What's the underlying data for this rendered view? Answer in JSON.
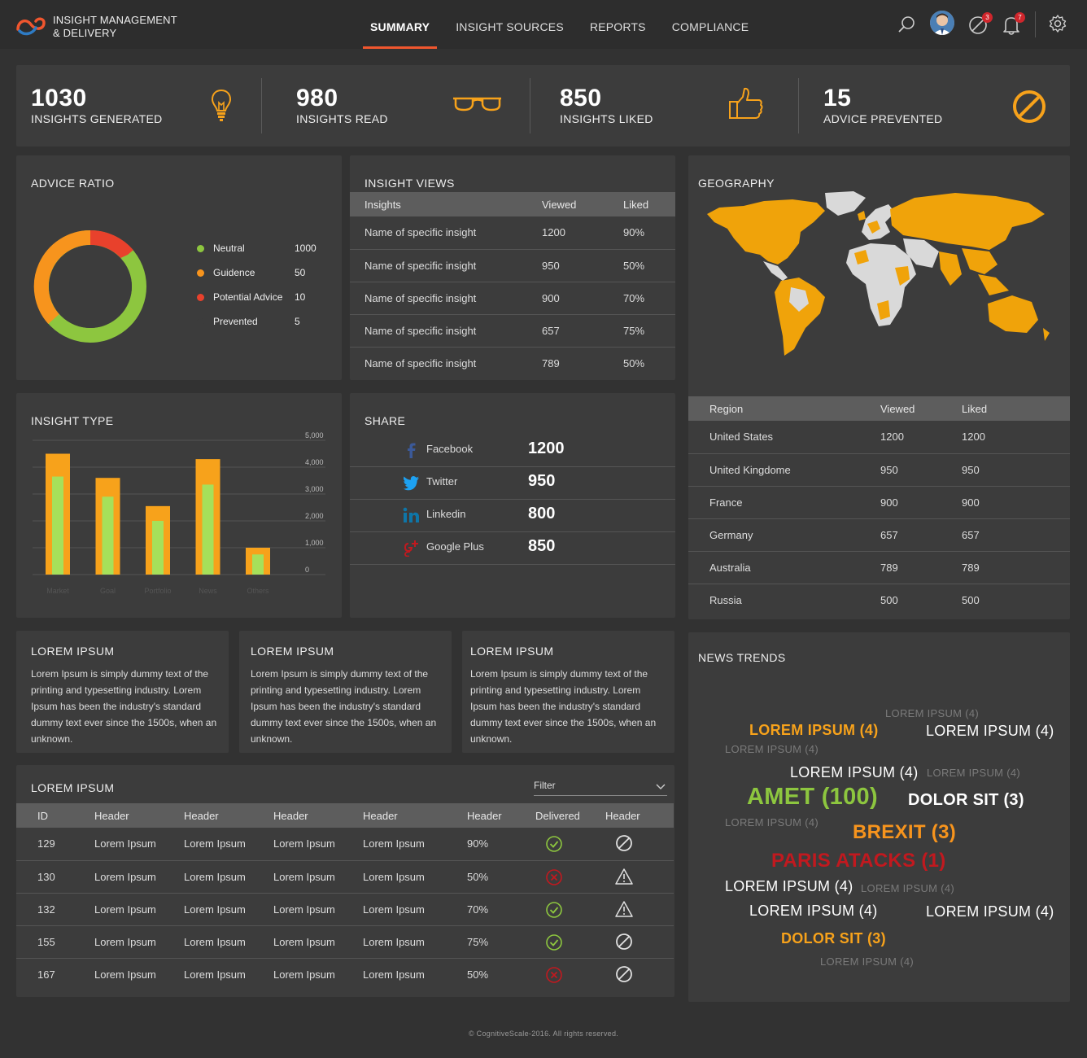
{
  "app": {
    "brand_line1": "INSIGHT MANAGEMENT",
    "brand_line2": "& DELIVERY"
  },
  "nav": {
    "items": [
      {
        "label": "SUMMARY",
        "active": true
      },
      {
        "label": "INSIGHT SOURCES",
        "active": false
      },
      {
        "label": "REPORTS",
        "active": false
      },
      {
        "label": "COMPLIANCE",
        "active": false
      }
    ],
    "icons": [
      "search-icon",
      "avatar",
      "prevented-icon",
      "bell-icon",
      "gear-icon"
    ],
    "prevented_badge": "3",
    "alerts_badge": "7"
  },
  "kpis": [
    {
      "value": "1030",
      "label": "INSIGHTS GENERATED",
      "icon": "lightbulb-icon"
    },
    {
      "value": "980",
      "label": "INSIGHTS READ",
      "icon": "glasses-icon"
    },
    {
      "value": "850",
      "label": "INSIGHTS LIKED",
      "icon": "thumbs-up-icon"
    },
    {
      "value": "15",
      "label": "ADVICE PREVENTED",
      "icon": "prohibited-icon"
    }
  ],
  "advice_ratio": {
    "title": "ADVICE RATIO",
    "legend": [
      {
        "label": "Neutral",
        "value": "1000",
        "color": "#8dc63f"
      },
      {
        "label": "Guidence",
        "value": "50",
        "color": "#f7941d"
      },
      {
        "label": "Potential Advice",
        "value": "10",
        "color": "#e8412c"
      },
      {
        "label": "Prevented",
        "value": "5",
        "color": "#3c3c3c"
      }
    ]
  },
  "insight_views": {
    "title": "INSIGHT VIEWS",
    "headers": [
      "Insights",
      "Viewed",
      "Liked"
    ],
    "rows": [
      [
        "Name of specific insight",
        "1200",
        "90%"
      ],
      [
        "Name of specific insight",
        "950",
        "50%"
      ],
      [
        "Name of specific insight",
        "900",
        "70%"
      ],
      [
        "Name of specific insight",
        "657",
        "75%"
      ],
      [
        "Name of specific insight",
        "789",
        "50%"
      ]
    ]
  },
  "geography": {
    "title": "GEOGRAPHY",
    "headers": [
      "Region",
      "Viewed",
      "Liked"
    ],
    "rows": [
      [
        "United States",
        "1200",
        "1200"
      ],
      [
        "United Kingdome",
        "950",
        "950"
      ],
      [
        "France",
        "900",
        "900"
      ],
      [
        "Germany",
        "657",
        "657"
      ],
      [
        "Australia",
        "789",
        "789"
      ],
      [
        "Russia",
        "500",
        "500"
      ]
    ]
  },
  "insight_type": {
    "title": "INSIGHT TYPE"
  },
  "chart_data": {
    "type": "bar",
    "categories": [
      "Market",
      "Goal",
      "Portfolio",
      "News",
      "Others"
    ],
    "series": [
      {
        "values": [
          4500,
          3600,
          2550,
          4300,
          1000
        ],
        "color": "#f7a21b"
      },
      {
        "values": [
          3650,
          2900,
          2000,
          3350,
          750
        ],
        "color": "#a6e05a"
      }
    ],
    "yticks": [
      "5,000",
      "4,000",
      "3,000",
      "2,000",
      "1,000",
      "0"
    ],
    "ylim": [
      0,
      5000
    ],
    "grid": true
  },
  "share": {
    "title": "SHARE",
    "rows": [
      {
        "name": "Facebook",
        "value": "1200",
        "icon": "facebook-icon"
      },
      {
        "name": "Twitter",
        "value": "950",
        "icon": "twitter-icon"
      },
      {
        "name": "Linkedin",
        "value": "800",
        "icon": "linkedin-icon"
      },
      {
        "name": "Google Plus",
        "value": "850",
        "icon": "google-plus-icon"
      }
    ]
  },
  "cards": [
    {
      "title": "LOREM IPSUM",
      "text": "Lorem Ipsum is simply dummy text of the printing and typesetting industry. Lorem Ipsum has been the industry's standard dummy text ever since the 1500s, when an unknown."
    },
    {
      "title": "LOREM IPSUM",
      "text": "Lorem Ipsum is simply dummy text of the printing and typesetting industry. Lorem Ipsum has been the industry's standard dummy text ever since the 1500s, when an unknown."
    },
    {
      "title": "LOREM IPSUM",
      "text": "Lorem Ipsum is simply dummy text of the printing and typesetting industry. Lorem Ipsum has been the industry's standard dummy text ever since the 1500s, when an unknown."
    }
  ],
  "lorem_table": {
    "title": "LOREM IPSUM",
    "filter_label": "Filter",
    "headers": [
      "ID",
      "Header",
      "Header",
      "Header",
      "Header",
      "Header",
      "Delivered",
      "Header"
    ],
    "rows": [
      {
        "id": "129",
        "c1": "Lorem Ipsum",
        "c2": "Lorem Ipsum",
        "c3": "Lorem Ipsum",
        "c4": "Lorem Ipsum",
        "pct": "90%",
        "delivered": "check-icon",
        "status": "prohibited-icon"
      },
      {
        "id": "130",
        "c1": "Lorem Ipsum",
        "c2": "Lorem Ipsum",
        "c3": "Lorem Ipsum",
        "c4": "Lorem Ipsum",
        "pct": "50%",
        "delivered": "x-icon",
        "status": "warning-icon"
      },
      {
        "id": "132",
        "c1": "Lorem Ipsum",
        "c2": "Lorem Ipsum",
        "c3": "Lorem Ipsum",
        "c4": "Lorem Ipsum",
        "pct": "70%",
        "delivered": "check-icon",
        "status": "warning-icon"
      },
      {
        "id": "155",
        "c1": "Lorem Ipsum",
        "c2": "Lorem Ipsum",
        "c3": "Lorem Ipsum",
        "c4": "Lorem Ipsum",
        "pct": "75%",
        "delivered": "check-icon",
        "status": "prohibited-icon"
      },
      {
        "id": "167",
        "c1": "Lorem Ipsum",
        "c2": "Lorem Ipsum",
        "c3": "Lorem Ipsum",
        "c4": "Lorem Ipsum",
        "pct": "50%",
        "delivered": "x-icon",
        "status": "prohibited-icon"
      }
    ]
  },
  "news_trends": {
    "title": "NEWS TRENDS",
    "tags": [
      {
        "text": "LOREM IPSUM (4)",
        "color": "#7a7a7a"
      },
      {
        "text": "LOREM IPSUM (4)",
        "color": "#f7a21b"
      },
      {
        "text": "LOREM IPSUM (4)",
        "color": "#ffffff"
      },
      {
        "text": "LOREM IPSUM (4)",
        "color": "#7a7a7a"
      },
      {
        "text": "LOREM IPSUM (4)",
        "color": "#ffffff"
      },
      {
        "text": "LOREM IPSUM (4)",
        "color": "#7a7a7a"
      },
      {
        "text": "AMET (100)",
        "color": "#8dc63f"
      },
      {
        "text": "DOLOR SIT (3)",
        "color": "#ffffff"
      },
      {
        "text": "LOREM IPSUM (4)",
        "color": "#7a7a7a"
      },
      {
        "text": "BREXIT (3)",
        "color": "#f7941d"
      },
      {
        "text": "PARIS ATACKS (1)",
        "color": "#c1191f"
      },
      {
        "text": "LOREM IPSUM (4)",
        "color": "#ffffff"
      },
      {
        "text": "LOREM IPSUM (4)",
        "color": "#7a7a7a"
      },
      {
        "text": "LOREM IPSUM (4)",
        "color": "#ffffff"
      },
      {
        "text": "LOREM IPSUM (4)",
        "color": "#ffffff"
      },
      {
        "text": "DOLOR SIT (3)",
        "color": "#f7a21b"
      },
      {
        "text": "LOREM IPSUM (4)",
        "color": "#7a7a7a"
      }
    ]
  },
  "footer": "© CognitiveScale-2016. All rights reserved."
}
